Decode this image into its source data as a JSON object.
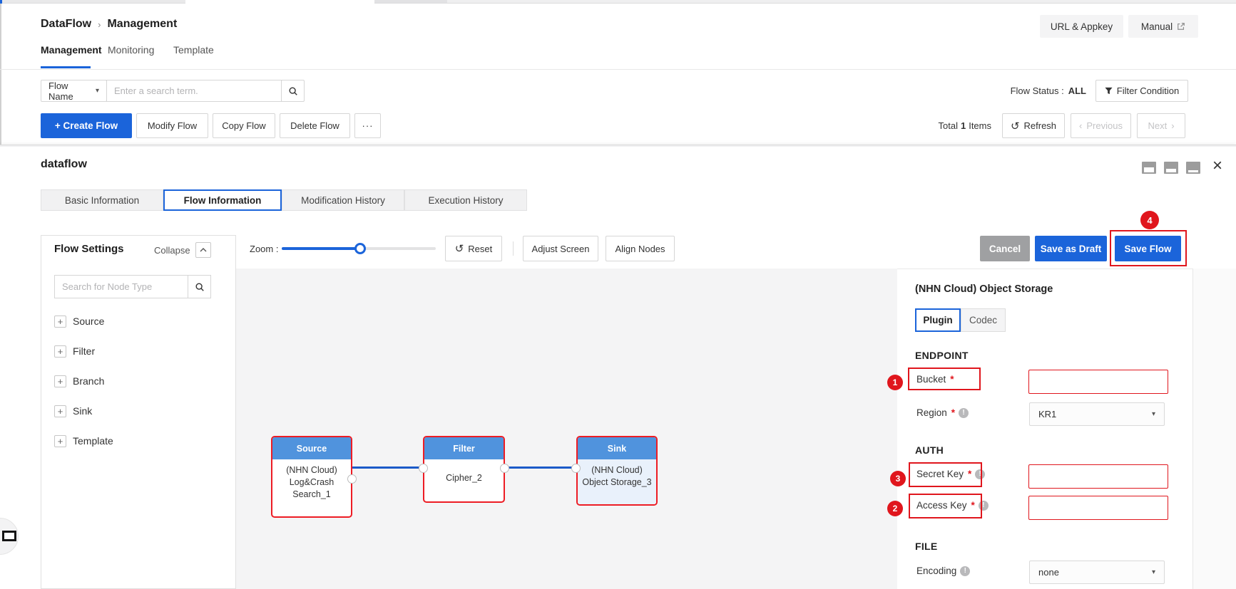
{
  "colors": {
    "accent": "#1b64da",
    "annotation_red": "#e0161d",
    "node_header_blue": "#5093dd"
  },
  "icons": {
    "breadcrumb_sep": "›",
    "caret_down": "▾",
    "more": "···",
    "refresh": "↺",
    "prev_chevron": "‹",
    "next_chevron": "›",
    "close": "×",
    "plus": "+",
    "info": "!",
    "required": "*"
  },
  "header": {
    "breadcrumb": [
      "DataFlow",
      "Management"
    ],
    "url_appkey_button": "URL & Appkey",
    "manual_button": "Manual"
  },
  "nav_tabs": {
    "items": [
      "Management",
      "Monitoring",
      "Template"
    ],
    "active": "Management"
  },
  "filter_bar": {
    "field_selector": "Flow Name",
    "search_placeholder": "Enter a search term.",
    "status_label": "Flow Status :",
    "status_value": "ALL",
    "filter_condition_button": "Filter Condition"
  },
  "action_bar": {
    "create_button": "+ Create Flow",
    "modify_button": "Modify Flow",
    "copy_button": "Copy Flow",
    "delete_button": "Delete Flow",
    "total_label": "Total",
    "total_count": "1",
    "total_items": "Items",
    "refresh_button": "Refresh",
    "previous_button": "Previous",
    "next_button": "Next"
  },
  "detail_panel": {
    "title": "dataflow",
    "tabs": [
      "Basic Information",
      "Flow Information",
      "Modification History",
      "Execution History"
    ],
    "active_tab": "Flow Information"
  },
  "flow_settings": {
    "title": "Flow Settings",
    "collapse_label": "Collapse",
    "search_placeholder": "Search for Node Type",
    "node_types": [
      "Source",
      "Filter",
      "Branch",
      "Sink",
      "Template"
    ]
  },
  "toolbar": {
    "zoom_label": "Zoom :",
    "reset_button": "Reset",
    "adjust_screen_button": "Adjust Screen",
    "align_nodes_button": "Align Nodes",
    "cancel_button": "Cancel",
    "save_draft_button": "Save as Draft",
    "save_flow_button": "Save Flow"
  },
  "canvas": {
    "nodes": [
      {
        "type": "Source",
        "lines": [
          "(NHN Cloud)",
          "Log&Crash",
          "Search_1"
        ]
      },
      {
        "type": "Filter",
        "lines": [
          "Cipher_2"
        ]
      },
      {
        "type": "Sink",
        "lines": [
          "(NHN Cloud)",
          "Object Storage_3"
        ]
      }
    ]
  },
  "properties": {
    "title": "(NHN Cloud) Object Storage",
    "tabs": [
      "Plugin",
      "Codec"
    ],
    "active_tab": "Plugin",
    "endpoint_header": "ENDPOINT",
    "bucket_label": "Bucket",
    "region_label": "Region",
    "region_value": "KR1",
    "auth_header": "AUTH",
    "secret_key_label": "Secret Key",
    "access_key_label": "Access Key",
    "file_header": "FILE",
    "encoding_label": "Encoding",
    "encoding_value": "none"
  },
  "annotations": {
    "step1": "1",
    "step2": "2",
    "step3": "3",
    "step4": "4"
  }
}
